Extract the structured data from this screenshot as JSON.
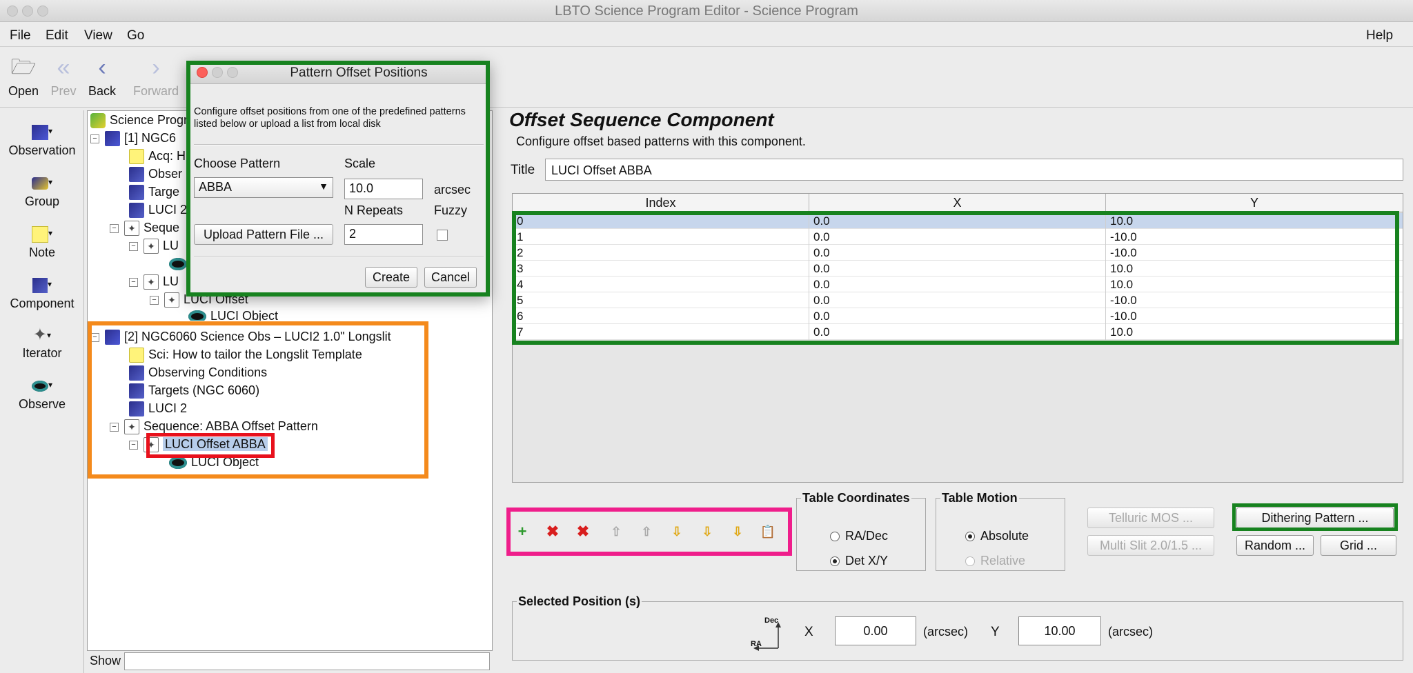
{
  "window": {
    "title": "LBTO Science Program Editor - Science Program"
  },
  "menu": {
    "file": "File",
    "edit": "Edit",
    "view": "View",
    "go": "Go",
    "help": "Help"
  },
  "toolbar": {
    "open": "Open",
    "prev": "Prev",
    "back": "Back",
    "forward": "Forward"
  },
  "palette": [
    {
      "label": "Observation",
      "icon": "observation-icon"
    },
    {
      "label": "Group",
      "icon": "group-icon"
    },
    {
      "label": "Note",
      "icon": "note-icon"
    },
    {
      "label": "Component",
      "icon": "component-icon"
    },
    {
      "label": "Iterator",
      "icon": "iterator-icon"
    },
    {
      "label": "Observe",
      "icon": "eye-icon"
    }
  ],
  "tree": {
    "root": "Science Progr",
    "obs1": "[1] NGC6",
    "obs1_children": [
      "Acq: H",
      "Obser",
      "Targe",
      "LUCI 2",
      "Seque",
      "LU",
      "LU",
      "LUCI Offset",
      "LUCI Object"
    ],
    "obs2": "[2] NGC6060 Science Obs – LUCI2 1.0\" Longslit",
    "obs2_children": [
      "Sci: How to tailor the Longslit Template",
      "Observing Conditions",
      "Targets (NGC 6060)",
      "LUCI 2",
      "Sequence: ABBA Offset Pattern",
      "LUCI Offset ABBA",
      "LUCI Object"
    ],
    "show_label": "Show"
  },
  "editor": {
    "heading": "Offset Sequence Component",
    "subheading": "Configure offset based patterns with this component.",
    "title_label": "Title",
    "title_value": "LUCI Offset ABBA",
    "columns": [
      "Index",
      "X",
      "Y"
    ],
    "rows": [
      [
        "0",
        "0.0",
        "10.0"
      ],
      [
        "1",
        "0.0",
        "-10.0"
      ],
      [
        "2",
        "0.0",
        "-10.0"
      ],
      [
        "3",
        "0.0",
        "10.0"
      ],
      [
        "4",
        "0.0",
        "10.0"
      ],
      [
        "5",
        "0.0",
        "-10.0"
      ],
      [
        "6",
        "0.0",
        "-10.0"
      ],
      [
        "7",
        "0.0",
        "10.0"
      ]
    ],
    "table_coordinates": {
      "legend": "Table Coordinates",
      "option1": "RA/Dec",
      "option2": "Det X/Y",
      "selected": "Det X/Y"
    },
    "table_motion": {
      "legend": "Table Motion",
      "option1": "Absolute",
      "option2": "Relative",
      "selected": "Absolute"
    },
    "buttons": {
      "telluric": "Telluric MOS ...",
      "multislit": "Multi Slit 2.0/1.5 ...",
      "dithering": "Dithering Pattern ...",
      "random": "Random ...",
      "grid": "Grid ..."
    },
    "selected_position": {
      "legend": "Selected Position (s)",
      "dec_label": "Dec",
      "ra_label": "RA",
      "x_label": "X",
      "x_value": "0.00",
      "x_unit": "(arcsec)",
      "y_label": "Y",
      "y_value": "10.00",
      "y_unit": "(arcsec)"
    }
  },
  "dialog": {
    "title": "Pattern Offset Positions",
    "description": "Configure offset positions from one of the predefined patterns listed below or upload a list from local disk",
    "choose_pattern_label": "Choose Pattern",
    "pattern_value": "ABBA",
    "scale_label": "Scale",
    "scale_value": "10.0",
    "scale_unit": "arcsec",
    "repeats_label": "N Repeats",
    "repeats_value": "2",
    "fuzzy_label": "Fuzzy",
    "upload_button": "Upload Pattern File ...",
    "create_button": "Create",
    "cancel_button": "Cancel"
  },
  "colors": {
    "highlight_green": "#17821f",
    "highlight_orange": "#f48a1c",
    "highlight_red": "#e8111c",
    "highlight_pink": "#ef1e8b",
    "selection_blue": "#c7d6ec"
  }
}
